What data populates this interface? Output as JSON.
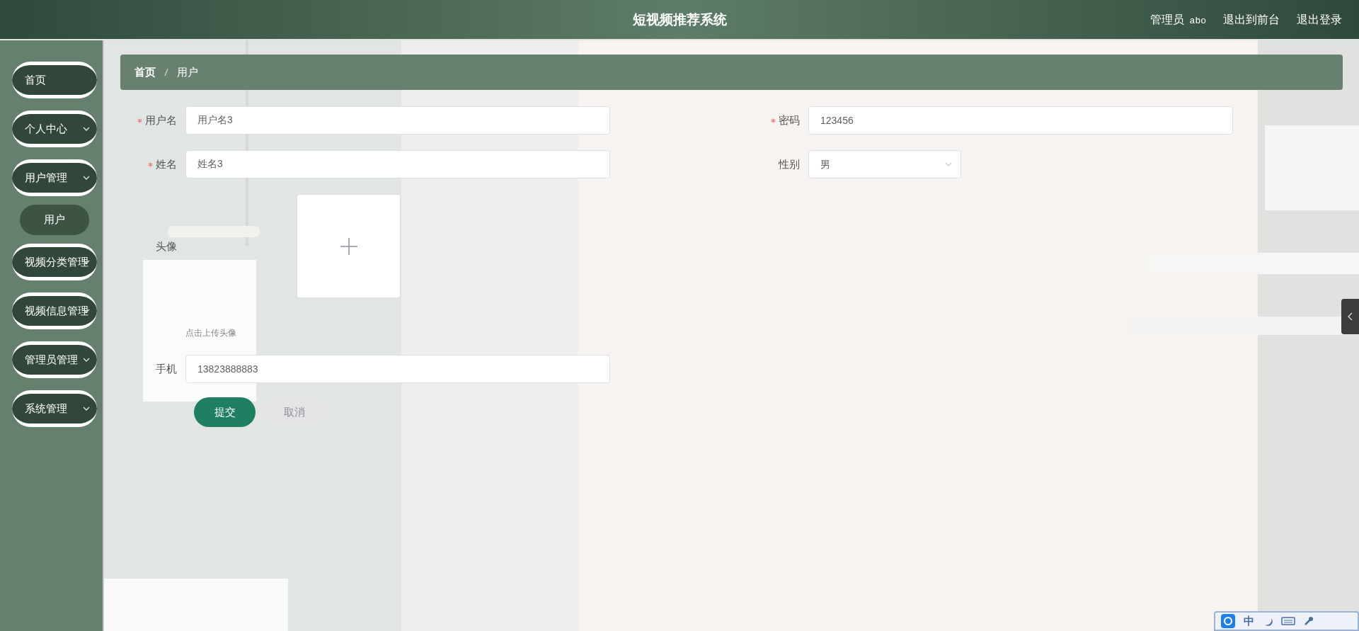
{
  "header": {
    "title": "短视频推荐系统",
    "user_role": "管理员",
    "username": "abo",
    "links": [
      "退出到前台",
      "退出登录"
    ]
  },
  "sidebar": {
    "items": [
      {
        "label": "首页",
        "expandable": false
      },
      {
        "label": "个人中心",
        "expandable": true,
        "expanded": false
      },
      {
        "label": "用户管理",
        "expandable": true,
        "expanded": true,
        "children": [
          {
            "label": "用户",
            "selected": true
          }
        ]
      },
      {
        "label": "视频分类管理",
        "expandable": true,
        "expanded": false
      },
      {
        "label": "视频信息管理",
        "expandable": true,
        "expanded": false
      },
      {
        "label": "管理员管理",
        "expandable": true,
        "expanded": false
      },
      {
        "label": "系统管理",
        "expandable": true,
        "expanded": false
      }
    ]
  },
  "breadcrumb": [
    "首页",
    "用户"
  ],
  "form": {
    "rows": [
      [
        {
          "kind": "input",
          "label": "用户名",
          "required": true,
          "value": "用户名3"
        },
        {
          "kind": "input",
          "label": "密码",
          "required": true,
          "value": "123456"
        }
      ],
      [
        {
          "kind": "input",
          "label": "姓名",
          "required": true,
          "value": "姓名3"
        },
        {
          "kind": "select",
          "label": "性别",
          "required": false,
          "value": "男"
        }
      ],
      [
        {
          "kind": "upload",
          "label": "头像",
          "required": false,
          "hint": "点击上传头像"
        }
      ],
      [
        {
          "kind": "input",
          "label": "手机",
          "required": false,
          "value": "13823888883"
        }
      ]
    ],
    "buttons": [
      {
        "label": "提交",
        "kind": "primary"
      },
      {
        "label": "取消",
        "kind": "secondary"
      }
    ]
  },
  "ime_toolbar": {
    "mode": "中"
  }
}
